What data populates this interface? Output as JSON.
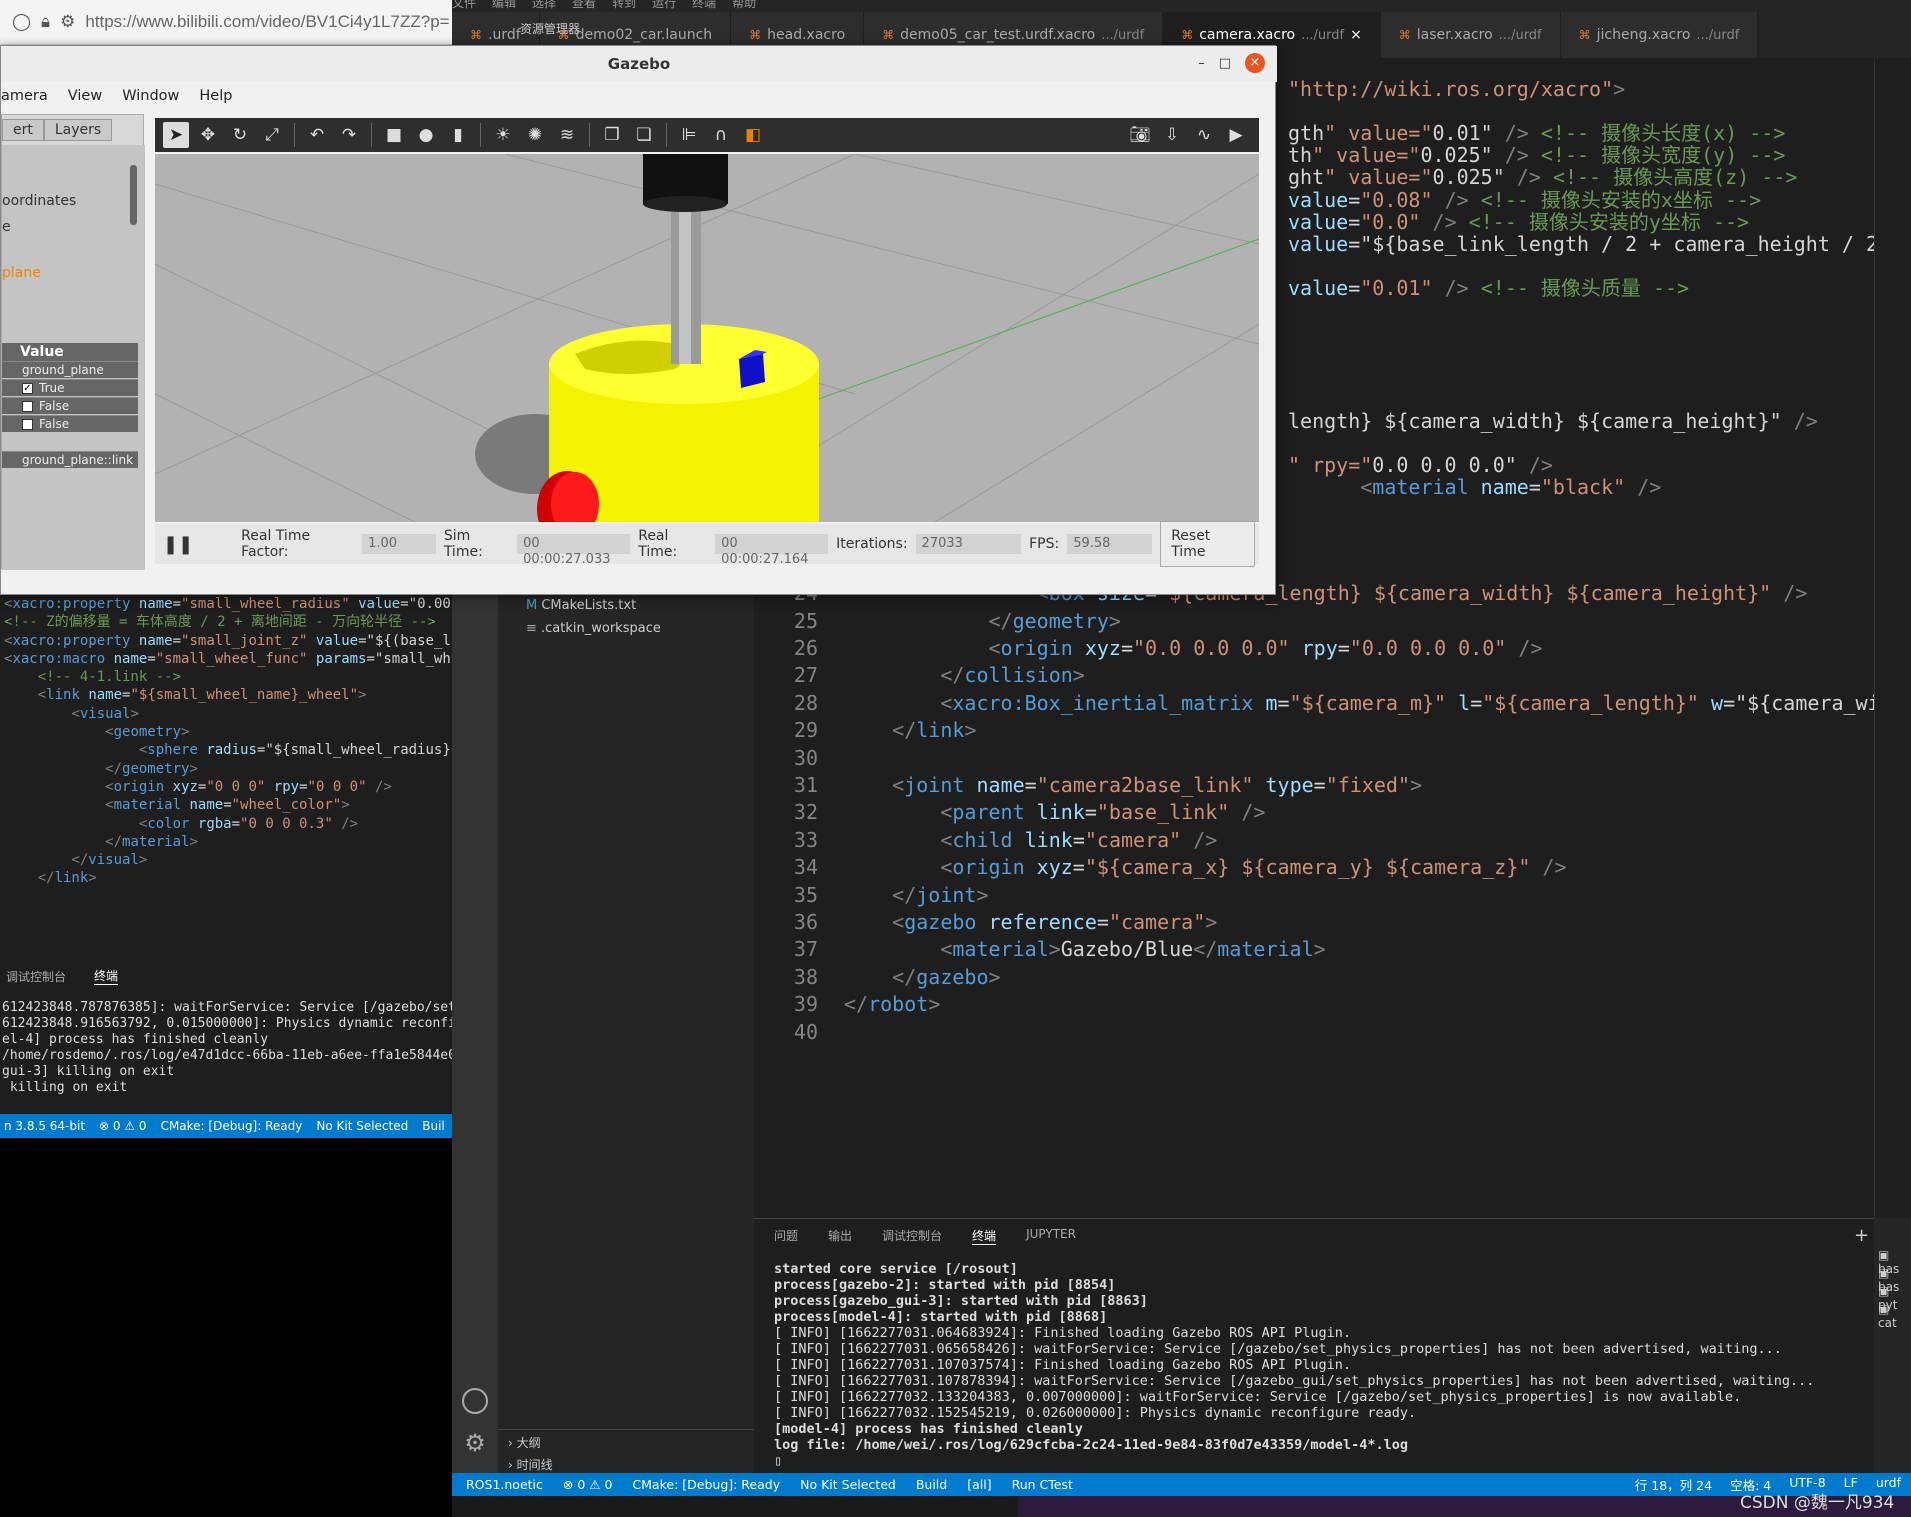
{
  "browser": {
    "url": "https://www.bilibili.com/video/BV1Ci4y1L7ZZ?p="
  },
  "vscode_menu": [
    "文件",
    "编辑",
    "选择",
    "查看",
    "转到",
    "运行",
    "终端",
    "帮助"
  ],
  "tabs": [
    {
      "name": ".urdf",
      "desc": ""
    },
    {
      "name": "demo02_car.launch",
      "desc": ""
    },
    {
      "name": "head.xacro",
      "desc": ""
    },
    {
      "name": "demo05_car_test.urdf.xacro",
      "desc": ".../urdf"
    },
    {
      "name": "camera.xacro",
      "desc": ".../urdf"
    },
    {
      "name": "laser.xacro",
      "desc": ".../urdf"
    },
    {
      "name": "jicheng.xacro",
      "desc": ".../urdf"
    }
  ],
  "explorer": {
    "title": "资源管理器",
    "files": [
      "CMakeLists.txt",
      ".catkin_workspace"
    ],
    "outline": "大纲",
    "timeline": "时间线"
  },
  "editor_top_lines": [
    "\"http://wiki.ros.org/xacro\">",
    "",
    "gth\" value=\"0.01\" /> <!-- 摄像头长度(x) -->",
    "th\" value=\"0.025\" /> <!-- 摄像头宽度(y) -->",
    "ght\" value=\"0.025\" /> <!-- 摄像头高度(z) -->",
    "value=\"0.08\" /> <!-- 摄像头安装的x坐标 -->",
    "value=\"0.0\" /> <!-- 摄像头安装的y坐标 -->",
    "value=\"${base_link_length / 2 + camera_height / 2}",
    "",
    "value=\"0.01\" /> <!-- 摄像头质量 -->",
    "",
    "",
    "",
    "",
    "",
    "length} ${camera_width} ${camera_height}\" />",
    "",
    "\" rpy=\"0.0 0.0 0.0\" />",
    "      <material name=\"black\" />"
  ],
  "editor_lines": [
    {
      "n": "21",
      "code": "        </visual>"
    },
    {
      "n": "22",
      "code": "        <collision>"
    },
    {
      "n": "23",
      "code": "            <geometry>"
    },
    {
      "n": "24",
      "code": "                <box size=\"${camera_length} ${camera_width} ${camera_height}\" />"
    },
    {
      "n": "25",
      "code": "            </geometry>"
    },
    {
      "n": "26",
      "code": "            <origin xyz=\"0.0 0.0 0.0\" rpy=\"0.0 0.0 0.0\" />"
    },
    {
      "n": "27",
      "code": "        </collision>"
    },
    {
      "n": "28",
      "code": "        <xacro:Box_inertial_matrix m=\"${camera_m}\" l=\"${camera_length}\" w=\"${camera_wi"
    },
    {
      "n": "29",
      "code": "    </link>"
    },
    {
      "n": "30",
      "code": ""
    },
    {
      "n": "31",
      "code": "    <joint name=\"camera2base_link\" type=\"fixed\">"
    },
    {
      "n": "32",
      "code": "        <parent link=\"base_link\" />"
    },
    {
      "n": "33",
      "code": "        <child link=\"camera\" />"
    },
    {
      "n": "34",
      "code": "        <origin xyz=\"${camera_x} ${camera_y} ${camera_z}\" />"
    },
    {
      "n": "35",
      "code": "    </joint>"
    },
    {
      "n": "36",
      "code": "    <gazebo reference=\"camera\">"
    },
    {
      "n": "37",
      "code": "        <material>Gazebo/Blue</material>"
    },
    {
      "n": "38",
      "code": "    </gazebo>"
    },
    {
      "n": "39",
      "code": "</robot>"
    },
    {
      "n": "40",
      "code": ""
    }
  ],
  "left_code": [
    "<xacro:property name=\"small_wheel_radius\" value=\"0.00",
    "<!-- Z的偏移量 = 车体高度 / 2 + 离地间距 - 万向轮半径 -->",
    "<xacro:property name=\"small_joint_z\" value=\"${(base_l",
    "",
    "<xacro:macro name=\"small_wheel_func\" params=\"small_wh",
    "    <!-- 4-1.link -->",
    "    <link name=\"${small_wheel_name}_wheel\">",
    "        <visual>",
    "            <geometry>",
    "                <sphere radius=\"${small_wheel_radius}",
    "            </geometry>",
    "",
    "            <origin xyz=\"0 0 0\" rpy=\"0 0 0\" />",
    "",
    "            <material name=\"wheel_color\">",
    "                <color rgba=\"0 0 0 0.3\" />",
    "            </material>",
    "        </visual>",
    "    </link>"
  ],
  "left_term_tabs": [
    "调试控制台",
    "终端"
  ],
  "left_term": [
    "612423848.787876385]: waitForService: Service [/gazebo/set_",
    "612423848.916563792, 0.015000000]: Physics dynamic reconfig",
    "el-4] process has finished cleanly",
    "/home/rosdemo/.ros/log/e47d1dcc-66ba-11eb-a6ee-ffa1e5844e0c",
    "gui-3] killing on exit",
    " killing on exit"
  ],
  "left_status": [
    "n 3.8.5 64-bit",
    "⊗ 0 ⚠ 0",
    "CMake: [Debug]: Ready",
    "No Kit Selected",
    "Buil"
  ],
  "panel_tabs": [
    "问题",
    "输出",
    "调试控制台",
    "终端",
    "JUPYTER"
  ],
  "terminal": [
    "started core service [/rosout]",
    "process[gazebo-2]: started with pid [8854]",
    "process[gazebo_gui-3]: started with pid [8863]",
    "process[model-4]: started with pid [8868]",
    "[ INFO] [1662277031.064683924]: Finished loading Gazebo ROS API Plugin.",
    "[ INFO] [1662277031.065658426]: waitForService: Service [/gazebo/set_physics_properties] has not been advertised, waiting...",
    "[ INFO] [1662277031.107037574]: Finished loading Gazebo ROS API Plugin.",
    "[ INFO] [1662277031.107878394]: waitForService: Service [/gazebo_gui/set_physics_properties] has not been advertised, waiting...",
    "[ INFO] [1662277032.133204383, 0.007000000]: waitForService: Service [/gazebo/set_physics_properties] is now available.",
    "[ INFO] [1662277032.152545219, 0.026000000]: Physics dynamic reconfigure ready.",
    "[model-4] process has finished cleanly",
    "log file: /home/wei/.ros/log/629cfcba-2c24-11ed-9e84-83f0d7e43359/model-4*.log"
  ],
  "term_side": [
    "bas",
    "bas",
    "pyt",
    "cat"
  ],
  "status": {
    "left": [
      "ROS1.noetic",
      "⊗ 0 ⚠ 0",
      "CMake: [Debug]: Ready",
      "No Kit Selected",
      "Build",
      "[all]",
      "Run CTest"
    ],
    "right": [
      "行 18，列 24",
      "空格: 4",
      "UTF-8",
      "LF",
      "urdf"
    ]
  },
  "watermark": "CSDN @魏一凡934",
  "gazebo": {
    "title": "Gazebo",
    "menu": [
      "amera",
      "View",
      "Window",
      "Help"
    ],
    "left_tabs": [
      "ert",
      "Layers"
    ],
    "tree": [
      "oordinates",
      "e",
      "plane"
    ],
    "prop_header": "Value",
    "props": [
      "ground_plane",
      "True",
      "False",
      "False"
    ],
    "link": "ground_plane::link",
    "real_time_factor_label": "Real Time Factor:",
    "real_time_factor": "1.00",
    "sim_time_label": "Sim Time:",
    "sim_time": "00 00:00:27.033",
    "real_time_label": "Real Time:",
    "real_time": "00 00:00:27.164",
    "iterations_label": "Iterations:",
    "iterations": "27033",
    "fps_label": "FPS:",
    "fps": "59.58",
    "reset_button": "Reset Time"
  },
  "colors": {
    "accent": "#007acc",
    "robot_body": "#ffff00",
    "camera": "#1010d0",
    "wheel": "#e00000"
  }
}
